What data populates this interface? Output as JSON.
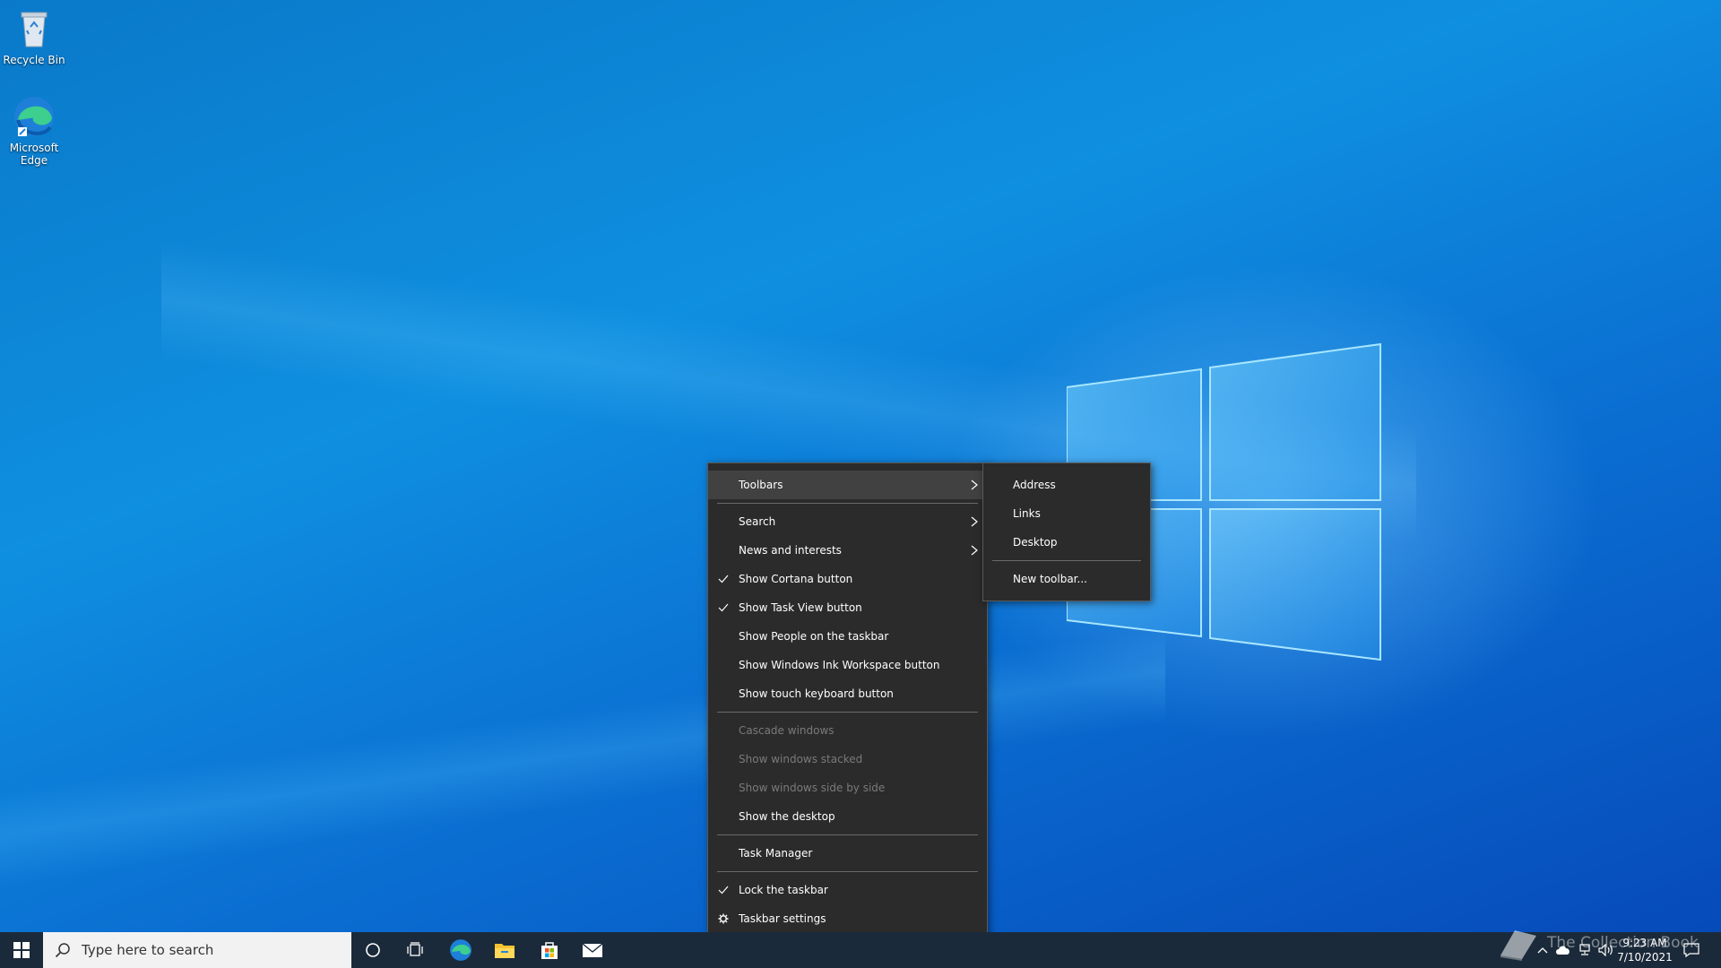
{
  "desktop": {
    "icons": [
      {
        "label": "Recycle Bin",
        "icon": "recycle-bin-icon"
      },
      {
        "label": "Microsoft Edge",
        "icon": "edge-icon"
      }
    ]
  },
  "context_menu": {
    "items": {
      "toolbars": "Toolbars",
      "search": "Search",
      "news": "News and interests",
      "cortana": "Show Cortana button",
      "taskview": "Show Task View button",
      "people": "Show People on the taskbar",
      "ink": "Show Windows Ink Workspace button",
      "touch_keyboard": "Show touch keyboard button",
      "cascade": "Cascade windows",
      "stacked": "Show windows stacked",
      "side_by_side": "Show windows side by side",
      "show_desktop": "Show the desktop",
      "task_manager": "Task Manager",
      "lock": "Lock the taskbar",
      "settings": "Taskbar settings"
    },
    "checked": [
      "Show Cortana button",
      "Show Task View button",
      "Lock the taskbar"
    ],
    "disabled": [
      "Cascade windows",
      "Show windows stacked",
      "Show windows side by side"
    ],
    "highlighted": "Toolbars"
  },
  "toolbars_submenu": {
    "address": "Address",
    "links": "Links",
    "desktop": "Desktop",
    "new_toolbar": "New toolbar..."
  },
  "taskbar": {
    "search_placeholder": "Type here to search",
    "pinned": [
      "cortana-icon",
      "task-view-icon",
      "edge-icon",
      "file-explorer-icon",
      "store-icon",
      "mail-icon"
    ],
    "clock_time": "9:23 AM",
    "clock_date": "7/10/2021"
  },
  "watermark": "The Collection Book",
  "colors": {
    "menu_bg": "#2b2b2b",
    "menu_highlight": "#414141",
    "disabled_text": "#7a7a7a",
    "taskbar_bg": "#1b2a3a"
  }
}
